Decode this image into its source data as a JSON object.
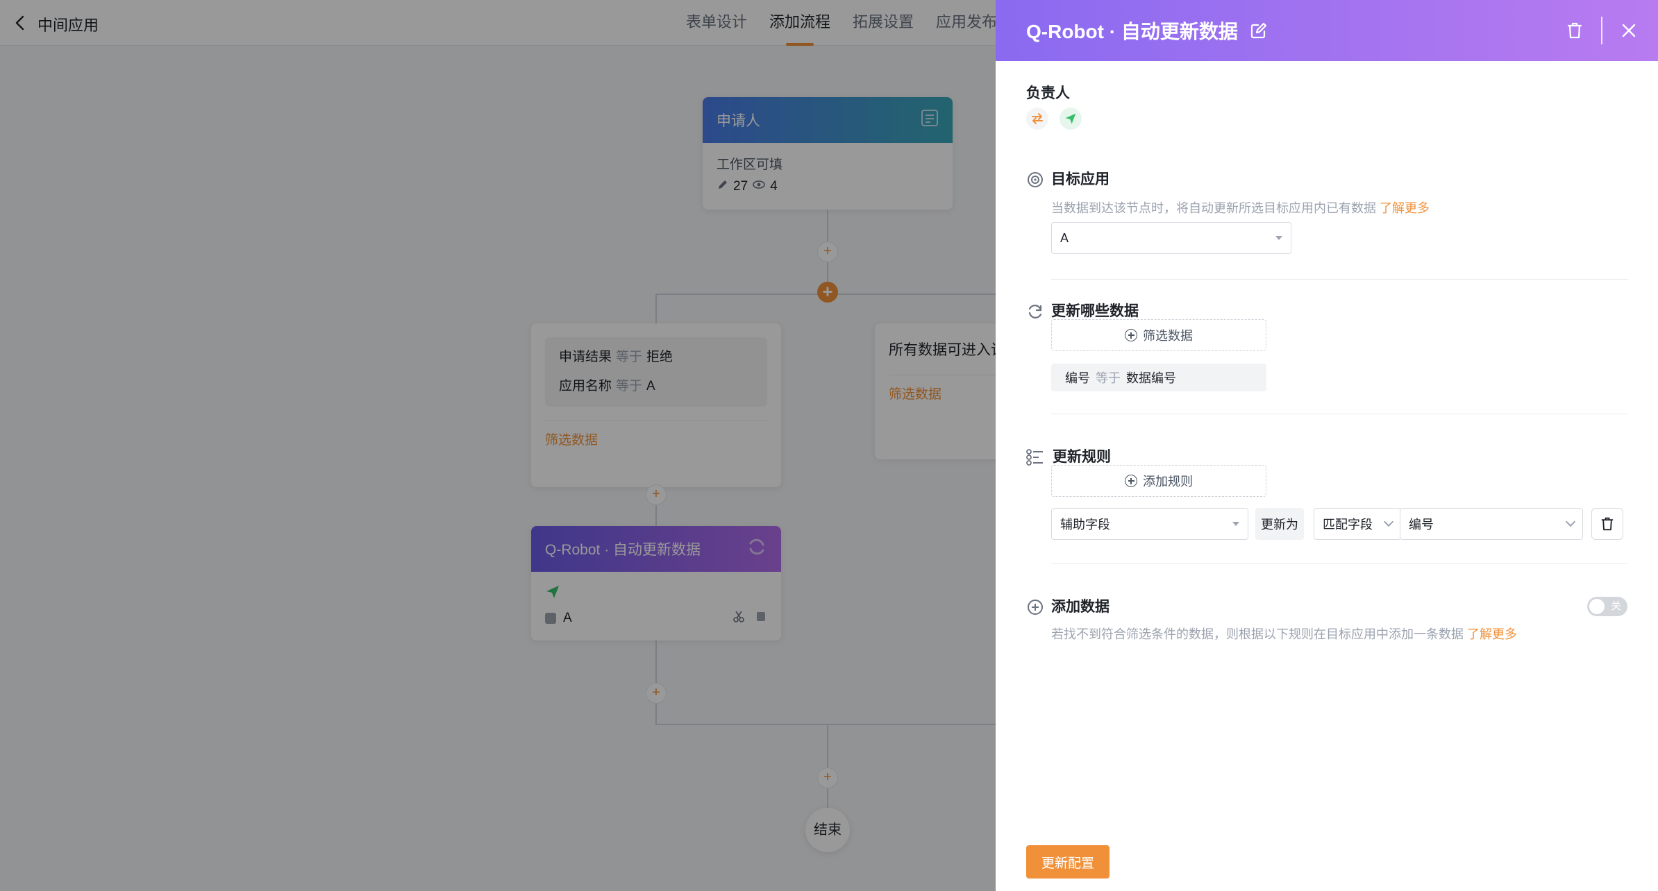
{
  "app": {
    "title": "中间应用",
    "tabs": [
      {
        "label": "表单设计"
      },
      {
        "label": "添加流程"
      },
      {
        "label": "拓展设置"
      },
      {
        "label": "应用发布"
      }
    ]
  },
  "flow": {
    "applicant": {
      "title": "申请人",
      "subtitle": "工作区可填",
      "edit_count": "27",
      "view_count": "4"
    },
    "branch_left": {
      "conditions": [
        {
          "field": "申请结果",
          "op": "等于",
          "value": "拒绝"
        },
        {
          "field": "应用名称",
          "op": "等于",
          "value": "A"
        }
      ],
      "link": "筛选数据"
    },
    "branch_right": {
      "title": "所有数据可进入该分支",
      "link": "筛选数据"
    },
    "robot_node": {
      "title": "Q-Robot · 自动更新数据",
      "app_value": "A"
    },
    "end_label": "结束"
  },
  "drawer": {
    "title": "Q-Robot · 自动更新数据",
    "owner_title": "负责人",
    "target": {
      "title": "目标应用",
      "desc": "当数据到达该节点时，将自动更新所选目标应用内已有数据",
      "link": "了解更多",
      "value": "A"
    },
    "which_data": {
      "title": "更新哪些数据",
      "filter_button": "筛选数据",
      "filter": {
        "field": "编号",
        "op": "等于",
        "value": "数据编号"
      }
    },
    "rules": {
      "title": "更新规则",
      "add_button": "添加规则",
      "row": {
        "field": "辅助字段",
        "action": "更新为",
        "mode": "匹配字段",
        "target": "编号"
      }
    },
    "add_data": {
      "title": "添加数据",
      "desc": "若找不到符合筛选条件的数据，则根据以下规则在目标应用中添加一条数据",
      "link": "了解更多",
      "toggle_label": "关",
      "toggle_on": false
    },
    "submit": "更新配置"
  },
  "colors": {
    "accent": "#f0913a",
    "header_start": "#8a6af0",
    "header_end": "#b87bf0"
  }
}
